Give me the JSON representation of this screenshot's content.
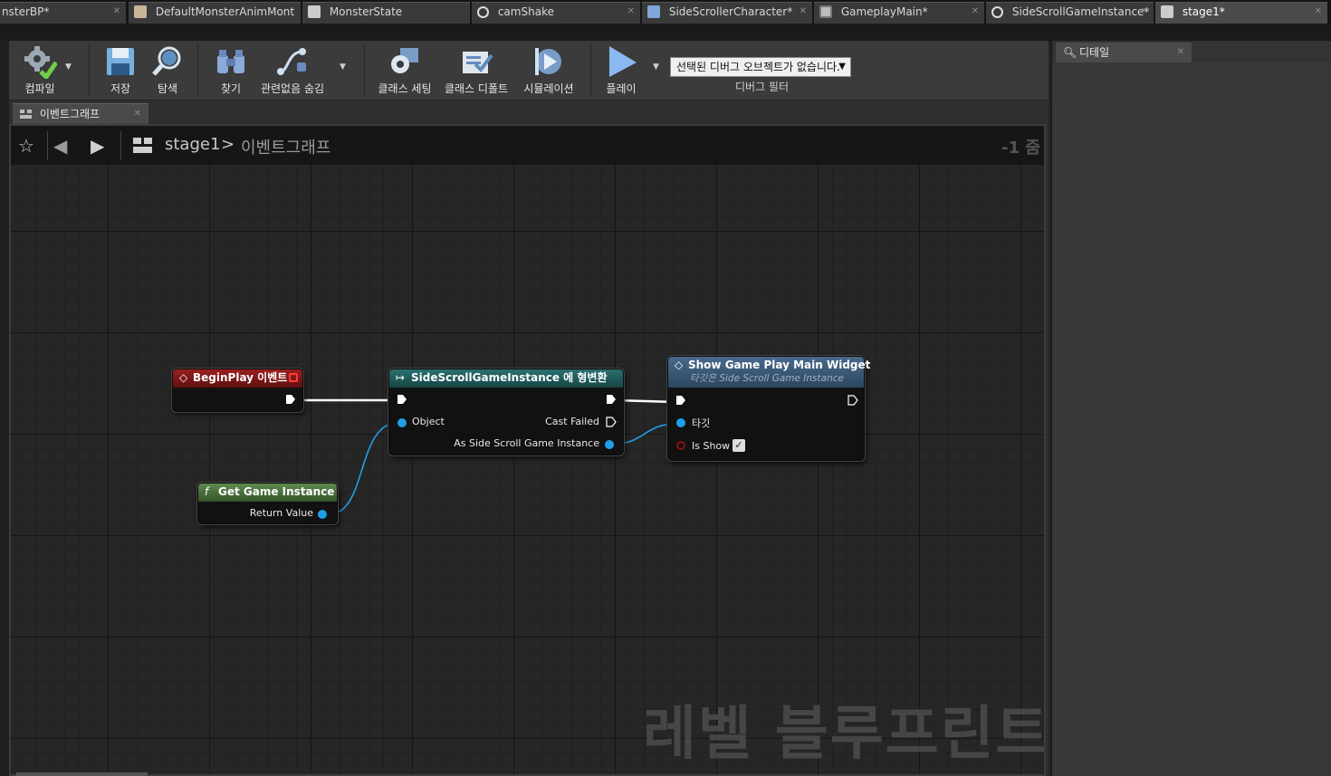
{
  "tabs": [
    {
      "label": "nsterBP*",
      "icon": "blueprint-icon",
      "active": false
    },
    {
      "label": "DefaultMonsterAnimMont",
      "icon": "anim-montage-icon",
      "active": false
    },
    {
      "label": "MonsterState",
      "icon": "document-icon",
      "active": false
    },
    {
      "label": "camShake",
      "icon": "circle-icon",
      "active": false
    },
    {
      "label": "SideScrollerCharacter*",
      "icon": "blueprint-icon",
      "active": false
    },
    {
      "label": "GameplayMain*",
      "icon": "widget-icon",
      "active": false
    },
    {
      "label": "SideScrollGameInstance*",
      "icon": "circle-icon",
      "active": false
    },
    {
      "label": "stage1*",
      "icon": "level-icon",
      "active": true
    }
  ],
  "toolbar": {
    "compile": "컴파일",
    "save": "저장",
    "browse": "탐색",
    "find": "찾기",
    "hide_unrelated": "관련없음 숨김",
    "class_settings": "클래스 세팅",
    "class_defaults": "클래스 디폴트",
    "simulation": "시뮬레이션",
    "play": "플레이",
    "debug_select": "선택된 디버그 오브젝트가 없습니다.",
    "debug_filter": "디버그 필터"
  },
  "graph_tab": "이벤트그래프",
  "breadcrumb": {
    "level": "stage1",
    "separator": ">",
    "graph": "이벤트그래프"
  },
  "zoom": "-1 줌",
  "watermark": "레벨 블루프린트",
  "nodes": {
    "begin_play": {
      "title": "BeginPlay 이벤트"
    },
    "cast": {
      "title": "SideScrollGameInstance 에 형변환",
      "pin_object": "Object",
      "pin_cast_failed": "Cast Failed",
      "pin_as": "As Side Scroll Game Instance"
    },
    "show_widget": {
      "title": "Show Game Play Main Widget",
      "subtitle": "타깃은 Side Scroll Game Instance",
      "pin_target": "타깃",
      "pin_is_show": "Is Show"
    },
    "get_game_instance": {
      "title": "Get Game Instance",
      "pin_return": "Return Value"
    }
  },
  "details": {
    "tab": "디테일"
  },
  "colors": {
    "event_header": "#8c1a1a",
    "cast_header": "#1e5a5a",
    "function_header": "#3a5a78",
    "pure_header": "#4a6a3a",
    "object_pin": "#1ea0e8"
  }
}
